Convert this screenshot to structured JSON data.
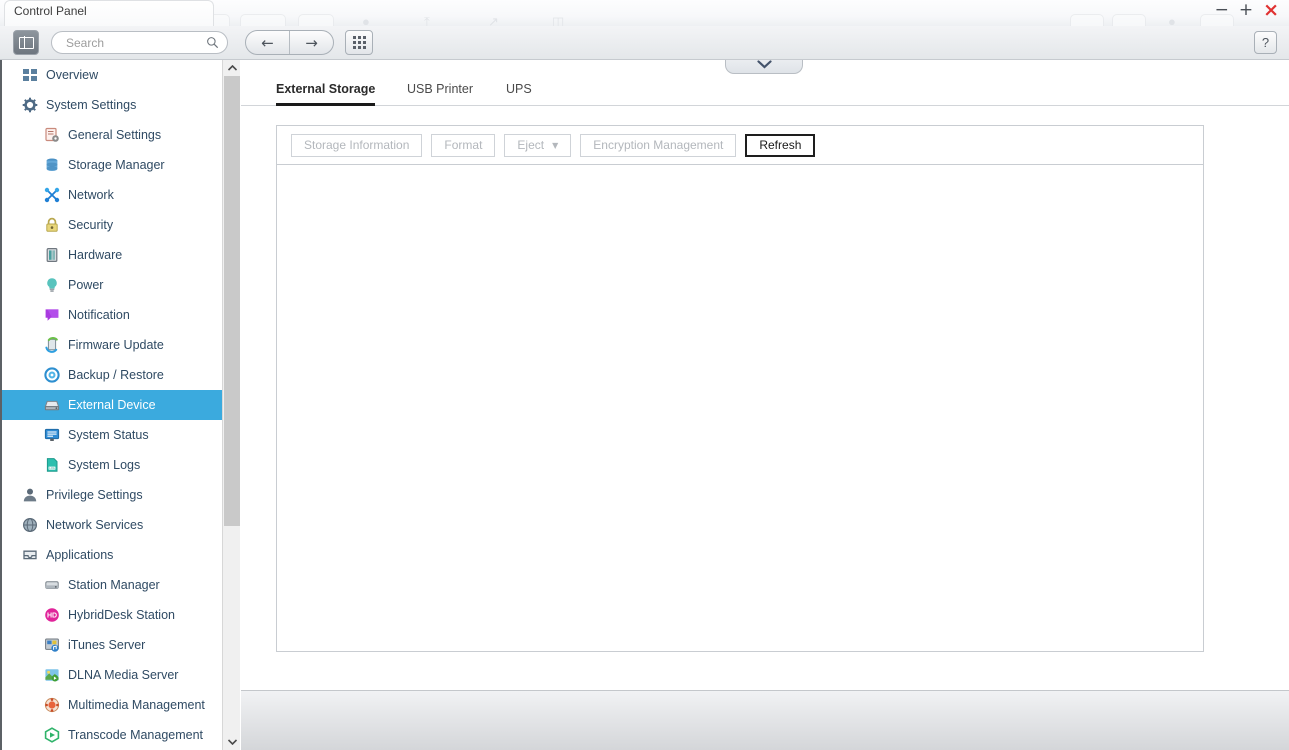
{
  "window": {
    "title": "Control Panel",
    "minimize_label": "−",
    "maximize_label": "+",
    "close_label": "×",
    "help_label": "?"
  },
  "toolbar": {
    "sidebar_toggle_name": "sidebar-toggle",
    "search_placeholder": "Search",
    "search_value": "",
    "back_label": "←",
    "forward_label": "→",
    "apps_label": "apps-grid"
  },
  "sidebar": {
    "items": [
      {
        "label": "Overview",
        "level": "group",
        "icon": "grid-squares-icon",
        "active": false
      },
      {
        "label": "System Settings",
        "level": "group",
        "icon": "gear-icon",
        "active": false
      },
      {
        "label": "General Settings",
        "level": "child",
        "icon": "clipboard-gear-icon",
        "active": false
      },
      {
        "label": "Storage Manager",
        "level": "child",
        "icon": "database-icon",
        "active": false
      },
      {
        "label": "Network",
        "level": "child",
        "icon": "network-nodes-icon",
        "active": false
      },
      {
        "label": "Security",
        "level": "child",
        "icon": "padlock-icon",
        "active": false
      },
      {
        "label": "Hardware",
        "level": "child",
        "icon": "hardware-chip-icon",
        "active": false
      },
      {
        "label": "Power",
        "level": "child",
        "icon": "lightbulb-icon",
        "active": false
      },
      {
        "label": "Notification",
        "level": "child",
        "icon": "speech-bubble-icon",
        "active": false
      },
      {
        "label": "Firmware Update",
        "level": "child",
        "icon": "firmware-refresh-icon",
        "active": false
      },
      {
        "label": "Backup / Restore",
        "level": "child",
        "icon": "backup-circle-icon",
        "active": false
      },
      {
        "label": "External Device",
        "level": "child",
        "icon": "external-drive-icon",
        "active": true
      },
      {
        "label": "System Status",
        "level": "child",
        "icon": "monitor-icon",
        "active": false
      },
      {
        "label": "System Logs",
        "level": "child",
        "icon": "log-document-icon",
        "active": false
      },
      {
        "label": "Privilege Settings",
        "level": "group",
        "icon": "user-icon",
        "active": false
      },
      {
        "label": "Network Services",
        "level": "group",
        "icon": "globe-icon",
        "active": false
      },
      {
        "label": "Applications",
        "level": "group",
        "icon": "app-tray-icon",
        "active": false
      },
      {
        "label": "Station Manager",
        "level": "child",
        "icon": "station-drive-icon",
        "active": false
      },
      {
        "label": "HybridDesk Station",
        "level": "child",
        "icon": "hybriddesk-icon",
        "active": false
      },
      {
        "label": "iTunes Server",
        "level": "child",
        "icon": "itunes-icon",
        "active": false
      },
      {
        "label": "DLNA Media Server",
        "level": "child",
        "icon": "dlna-media-icon",
        "active": false
      },
      {
        "label": "Multimedia Management",
        "level": "child",
        "icon": "multimedia-icon",
        "active": false
      },
      {
        "label": "Transcode Management",
        "level": "child",
        "icon": "transcode-icon",
        "active": false
      }
    ],
    "scroll_up_label": "▲",
    "scroll_down_label": "▼"
  },
  "main": {
    "collapse_label": "⌄",
    "tabs": [
      {
        "label": "External Storage",
        "active": true
      },
      {
        "label": "USB Printer",
        "active": false
      },
      {
        "label": "UPS",
        "active": false
      }
    ],
    "panel_buttons": [
      {
        "label": "Storage Information",
        "enabled": false,
        "has_caret": false
      },
      {
        "label": "Format",
        "enabled": false,
        "has_caret": false
      },
      {
        "label": "Eject",
        "enabled": false,
        "has_caret": true
      },
      {
        "label": "Encryption Management",
        "enabled": false,
        "has_caret": false
      },
      {
        "label": "Refresh",
        "enabled": true,
        "has_caret": false
      }
    ],
    "caret_label": "▼",
    "panel_empty_text": ""
  },
  "colors": {
    "accent_blue": "#3baade",
    "sidebar_text": "#2f4a63",
    "disabled_text": "#b3b7bc",
    "close_red": "#e03131"
  }
}
